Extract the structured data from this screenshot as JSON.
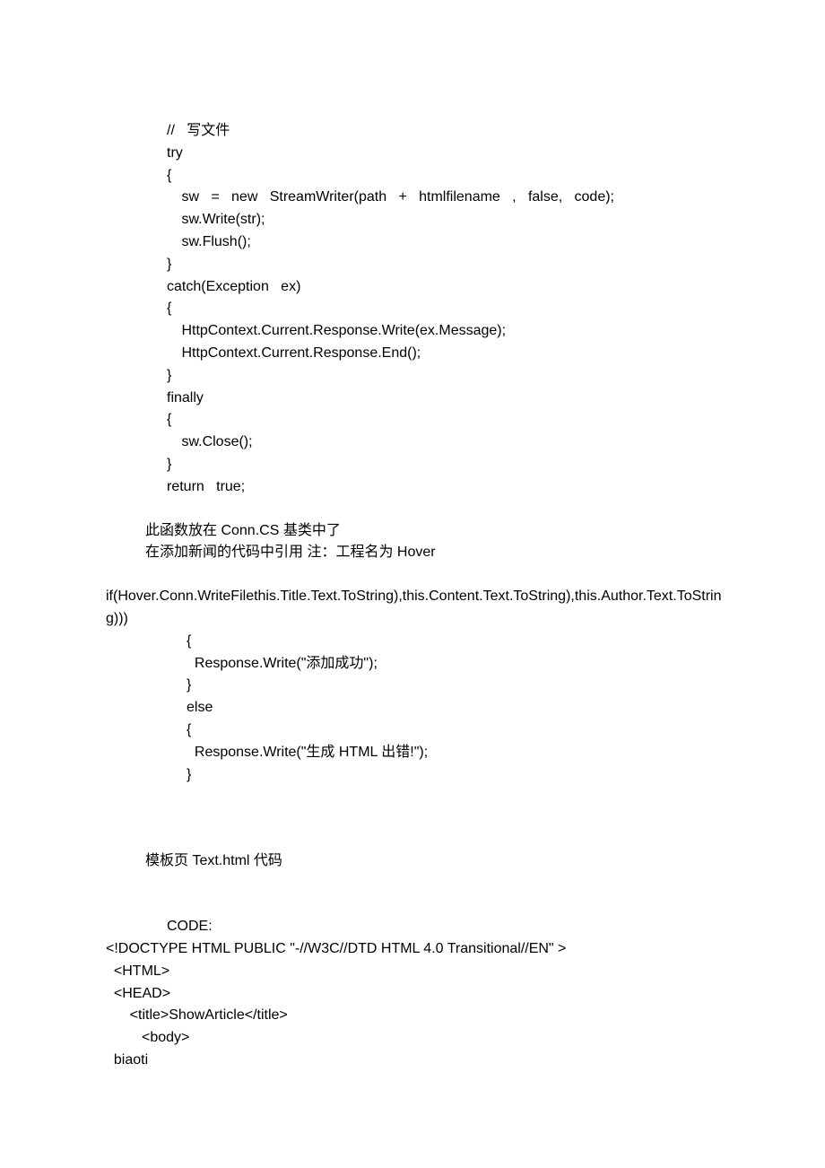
{
  "lines": [
    {
      "cls": "blank",
      "text": ""
    },
    {
      "cls": "code-line indent2",
      "text": "//   写文件"
    },
    {
      "cls": "code-line indent2",
      "text": "try"
    },
    {
      "cls": "code-line indent2",
      "text": "{"
    },
    {
      "cls": "code-line indent3",
      "text": " sw   =   new   StreamWriter(path   +   htmlfilename   ,   false,   code);"
    },
    {
      "cls": "code-line indent3",
      "text": " sw.Write(str);"
    },
    {
      "cls": "code-line indent3",
      "text": " sw.Flush();"
    },
    {
      "cls": "code-line indent2",
      "text": "}"
    },
    {
      "cls": "code-line indent2",
      "text": "catch(Exception   ex)"
    },
    {
      "cls": "code-line indent2",
      "text": "{"
    },
    {
      "cls": "code-line indent3",
      "text": " HttpContext.Current.Response.Write(ex.Message);"
    },
    {
      "cls": "code-line indent3",
      "text": " HttpContext.Current.Response.End();"
    },
    {
      "cls": "code-line indent2",
      "text": "}"
    },
    {
      "cls": "code-line indent2",
      "text": "finally"
    },
    {
      "cls": "code-line indent2",
      "text": "{"
    },
    {
      "cls": "code-line indent3",
      "text": " sw.Close();"
    },
    {
      "cls": "code-line indent2",
      "text": "}"
    },
    {
      "cls": "code-line indent2",
      "text": "return   true;"
    },
    {
      "cls": "blank",
      "text": ""
    },
    {
      "cls": "prose indent1",
      "text": "此函数放在 Conn.CS 基类中了"
    },
    {
      "cls": "prose indent1",
      "text": "在添加新闻的代码中引用   注：工程名为 Hover"
    },
    {
      "cls": "blank",
      "text": ""
    },
    {
      "cls": "code-line wrap indent0",
      "text": "          if(Hover.Conn.WriteFilethis.Title.Text.ToString),this.Content.Text.ToString),this.Author.Text.ToString)))"
    },
    {
      "cls": "code-line indent4",
      "text": "{"
    },
    {
      "cls": "code-line indent4",
      "text": "  Response.Write(\"添加成功\");"
    },
    {
      "cls": "code-line indent4",
      "text": "}"
    },
    {
      "cls": "code-line indent4",
      "text": "else"
    },
    {
      "cls": "code-line indent4",
      "text": "{"
    },
    {
      "cls": "code-line indent4",
      "text": "  Response.Write(\"生成 HTML 出错!\");"
    },
    {
      "cls": "code-line indent4",
      "text": "}"
    },
    {
      "cls": "blank2",
      "text": ""
    },
    {
      "cls": "blank",
      "text": ""
    },
    {
      "cls": "prose indent1",
      "text": "模板页 Text.html 代码"
    },
    {
      "cls": "blank2",
      "text": ""
    },
    {
      "cls": "code-line indent2",
      "text": "CODE:"
    },
    {
      "cls": "code-line wrap indent0",
      "text": "  <!DOCTYPE   HTML   PUBLIC   \"-//W3C//DTD   HTML   4.0   Transitional//EN\"   >"
    },
    {
      "cls": "code-line indent0",
      "text": "  <HTML>"
    },
    {
      "cls": "code-line indent0",
      "text": "  <HEAD>"
    },
    {
      "cls": "code-line indent0",
      "text": "      <title>ShowArticle</title>"
    },
    {
      "cls": "code-line indent0",
      "text": "         <body>"
    },
    {
      "cls": "code-line indent0",
      "text": "  biaoti"
    }
  ]
}
